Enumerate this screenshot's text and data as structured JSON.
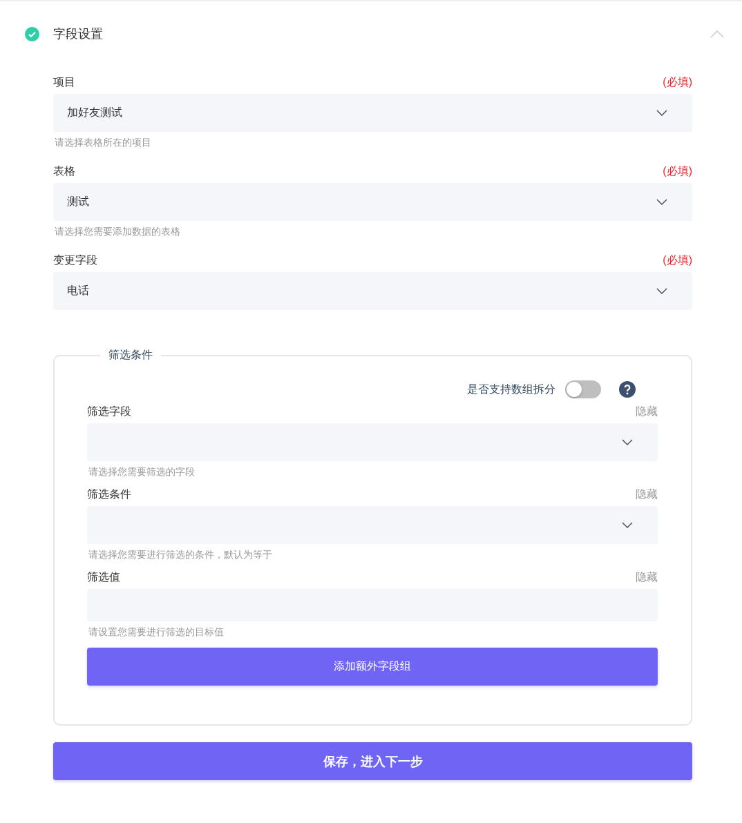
{
  "section": {
    "title": "字段设置",
    "completed": true,
    "expanded": true
  },
  "fields": [
    {
      "kind": "select",
      "label": "项目",
      "required_mark": "(必填)",
      "value": "加好友测试",
      "hint": "请选择表格所在的项目"
    },
    {
      "kind": "select",
      "label": "表格",
      "required_mark": "(必填)",
      "value": "测试",
      "hint": "请选择您需要添加数据的表格"
    },
    {
      "kind": "select",
      "label": "变更字段",
      "required_mark": "(必填)",
      "value": "电话"
    }
  ],
  "filter": {
    "legend": "筛选条件",
    "split_toggle": {
      "label": "是否支持数组拆分",
      "on": false
    },
    "fields": [
      {
        "kind": "select",
        "label": "筛选字段",
        "action": "隐藏",
        "hint": "请选择您需要筛选的字段"
      },
      {
        "kind": "select",
        "label": "筛选条件",
        "action": "隐藏",
        "hint": "请选择您需要进行筛选的条件，默认为等于"
      },
      {
        "kind": "input",
        "label": "筛选值",
        "action": "隐藏",
        "hint": "请设置您需要进行筛选的目标值"
      }
    ],
    "add_button": "添加额外字段组"
  },
  "save_button": "保存，进入下一步"
}
